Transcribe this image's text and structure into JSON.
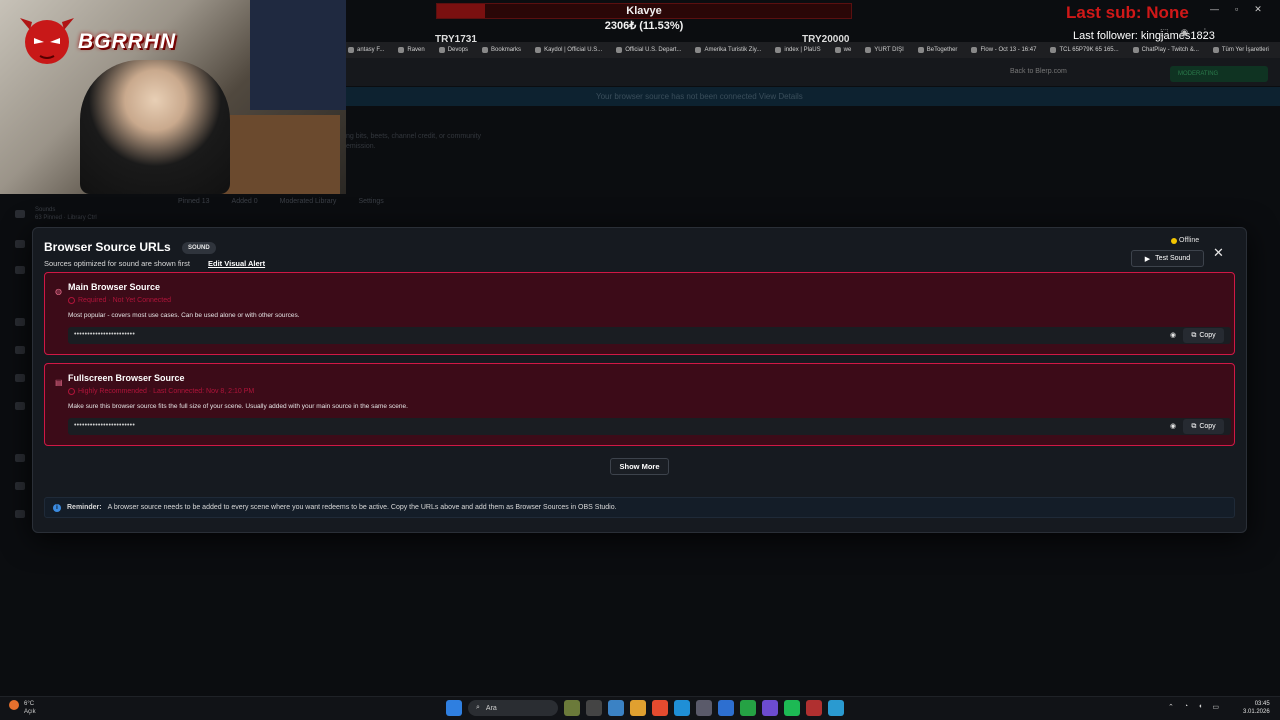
{
  "overlay": {
    "goal_title": "Klavye",
    "goal_amount": "2306₺ (11.53%)",
    "goal_progress": 0.1153,
    "goal_left": "TRY1731",
    "goal_right": "TRY20000",
    "last_sub": "Last sub: None",
    "last_follower": "Last follower: kingjames1823",
    "logo_text": "BGRRHN"
  },
  "bookmarks": [
    "antasy F...",
    "Raven",
    "Devops",
    "Bookmarks",
    "Kaydol | Official U.S...",
    "Official U.S. Depart...",
    "Amerika Turistik Ziy...",
    "index | PlaUS",
    "we",
    "YURT DIŞI",
    "BeTogether",
    "Flow - Oct 13 - 16:47",
    "TCL 65P79K 65 165...",
    "ChatPlay - Twitch &...",
    "Tüm Yer İşaretleri"
  ],
  "page": {
    "back_link": "Back to Blerp.com",
    "moderating_label": "MODERATING",
    "banner_text": "Your browser source has not been connected   View Details",
    "faded_desc_1": "ng bits, beets, channel credit, or community",
    "faded_desc_2": "emission.",
    "sounds_label": "Sounds",
    "sounds_sub": "63 Pinned · Library Ctrl",
    "bg_tabs": [
      "Pinned 13",
      "Added 0",
      "Moderated Library",
      "Settings"
    ]
  },
  "modal": {
    "title": "Browser Source URLs",
    "badge": "SOUND",
    "subtitle": "Sources optimized for sound are shown first",
    "edit_link": "Edit Visual Alert",
    "status": "Offline",
    "test_sound": "Test Sound",
    "close": "✕",
    "sources": [
      {
        "title": "Main Browser Source",
        "status": "Required · Not Yet Connected",
        "desc": "Most popular - covers most use cases. Can be used alone or with other sources.",
        "url_masked": "•••••••••••••••••••••••",
        "copy_label": "Copy",
        "icon": "speaker-icon"
      },
      {
        "title": "Fullscreen Browser Source",
        "status": "Highly Recommended · Last Connected: Nov 8, 2:10 PM",
        "desc": "Make sure this browser source fits the full size of your scene. Usually added with your main source in the same scene.",
        "url_masked": "•••••••••••••••••••••••",
        "copy_label": "Copy",
        "icon": "screen-icon"
      }
    ],
    "show_more": "Show More",
    "reminder_label": "Reminder:",
    "reminder_text": "A browser source needs to be added to every scene where you want redeems to be active. Copy the URLs above and add them as Browser Sources in OBS Studio."
  },
  "taskbar": {
    "weather_temp": "6°C",
    "weather_desc": "Açık",
    "search_placeholder": "Ara",
    "time": "03:45",
    "date": "3.01.2026"
  },
  "colors": {
    "card_border": "#d01845",
    "card_bg": "#3c0b18",
    "status_offline": "#f2c500",
    "last_sub": "#d01818"
  }
}
